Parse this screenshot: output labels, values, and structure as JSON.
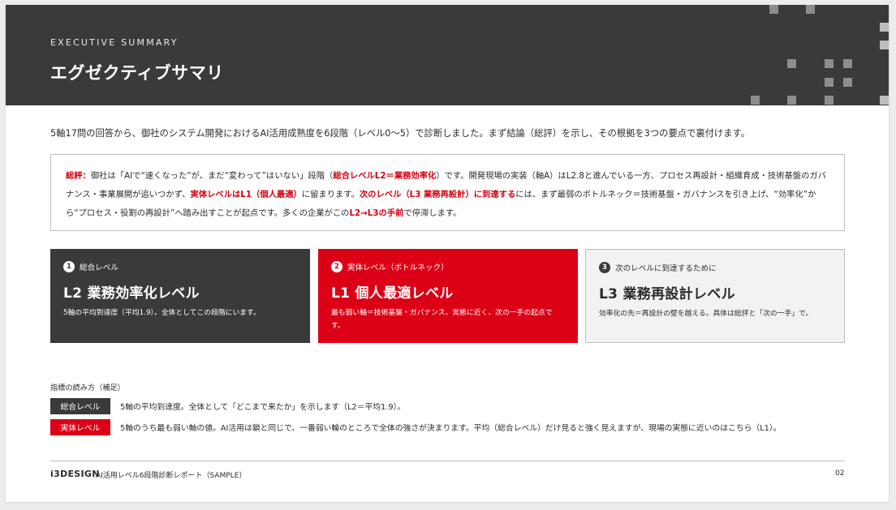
{
  "header": {
    "eyebrow": "EXECUTIVE SUMMARY",
    "title": "エグゼクティブサマリ"
  },
  "intro": "5軸17問の回答から、御社のシステム開発におけるAI活用成熟度を6段階（レベル0〜5）で診断しました。まず結論（総評）を示し、その根拠を3つの要点で裏付けます。",
  "summary": {
    "label": "総評：",
    "p1": "御社は「AIで“速くなった”が、まだ“変わって”はいない」段階（",
    "h1": "総合レベルL2＝業務効率化",
    "p2": "）です。開発現場の実装（軸A）はL2.8と進んでいる一方、プロセス再設計・組織育成・技術基盤のガバナンス・事業展開が追いつかず、",
    "h2": "実体レベルはL1（個人最適）",
    "p3": "に留まります。",
    "h3": "次のレベル（L3 業務再設計）に到達する",
    "p4": "には、まず最弱のボトルネック＝技術基盤・ガバナンスを引き上げ、“効率化”から“プロセス・役割の再設計”へ踏み出すことが起点です。多くの企業がこの",
    "h4": "L2→L3の手前",
    "p5": "で停滞します。"
  },
  "cards": [
    {
      "num": "1",
      "head": "総合レベル",
      "title": "L2 業務効率化レベル",
      "desc": "5軸の平均到達度（平均1.9）。全体としてこの段階にいます。"
    },
    {
      "num": "2",
      "head": "実体レベル（ボトルネック）",
      "title": "L1 個人最適レベル",
      "desc": "最も弱い軸＝技術基盤・ガバナンス。実態に近く、次の一手の起点です。"
    },
    {
      "num": "3",
      "head": "次のレベルに到達するために",
      "title": "L3 業務再設計レベル",
      "desc": "効率化の先＝再設計の壁を越える。具体は総評と「次の一手」で。"
    }
  ],
  "notes": {
    "title": "指標の読み方（補足）",
    "rows": [
      {
        "tag": "総合レベル",
        "text": "5軸の平均到達度。全体として「どこまで来たか」を示します（L2＝平均1.9）。"
      },
      {
        "tag": "実体レベル",
        "text": "5軸のうち最も弱い軸の値。AI活用は鎖と同じで、一番弱い輪のところで全体の強さが決まります。平均（総合レベル）だけ見ると強く見えますが、現場の実態に近いのはこちら（L1）。"
      }
    ]
  },
  "footer": {
    "brand": "i3DESIGN",
    "text": "AI活用レベル6段階診断レポート（SAMPLE）",
    "page": "02"
  },
  "colors": {
    "accent_red": "#dc0016",
    "dark": "#3a3a3a",
    "light_card": "#f2f2f2"
  }
}
